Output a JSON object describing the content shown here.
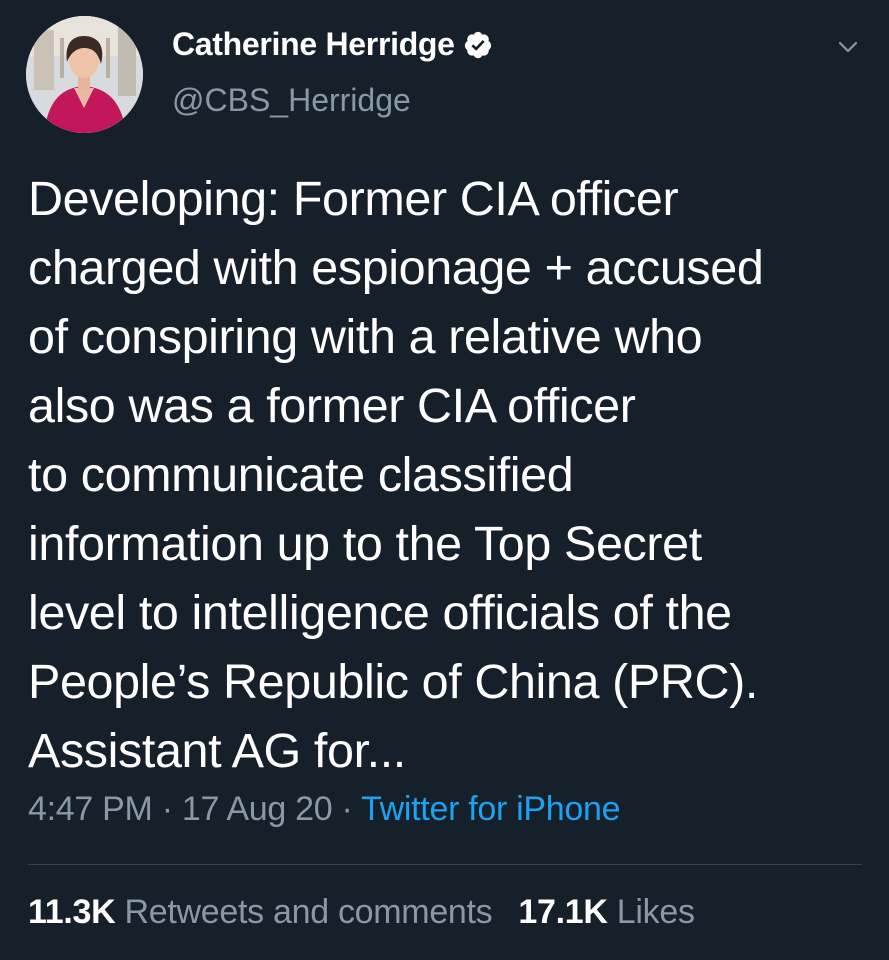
{
  "tweet": {
    "author": {
      "display_name": "Catherine Herridge",
      "handle": "@CBS_Herridge",
      "verified": true
    },
    "text": "Developing: Former CIA officer\ncharged with espionage + accused\nof conspiring with a relative who\nalso was a former CIA officer\nto communicate classified\ninformation up to the Top Secret\nlevel to intelligence officials of the\nPeople’s Republic of China (PRC).\nAssistant AG for...",
    "time": "4:47 PM",
    "date": "17 Aug 20",
    "separator": "·",
    "source": "Twitter for iPhone",
    "stats": {
      "retweets_count": "11.3K",
      "retweets_label": "Retweets and comments",
      "likes_count": "17.1K",
      "likes_label": "Likes"
    }
  },
  "icons": {
    "verified": "verified-badge-icon",
    "menu": "chevron-down-icon"
  },
  "colors": {
    "background": "#15202b",
    "text": "#ffffff",
    "secondary_text": "#8899a6",
    "link": "#1da1f2",
    "divider": "#38444d"
  }
}
